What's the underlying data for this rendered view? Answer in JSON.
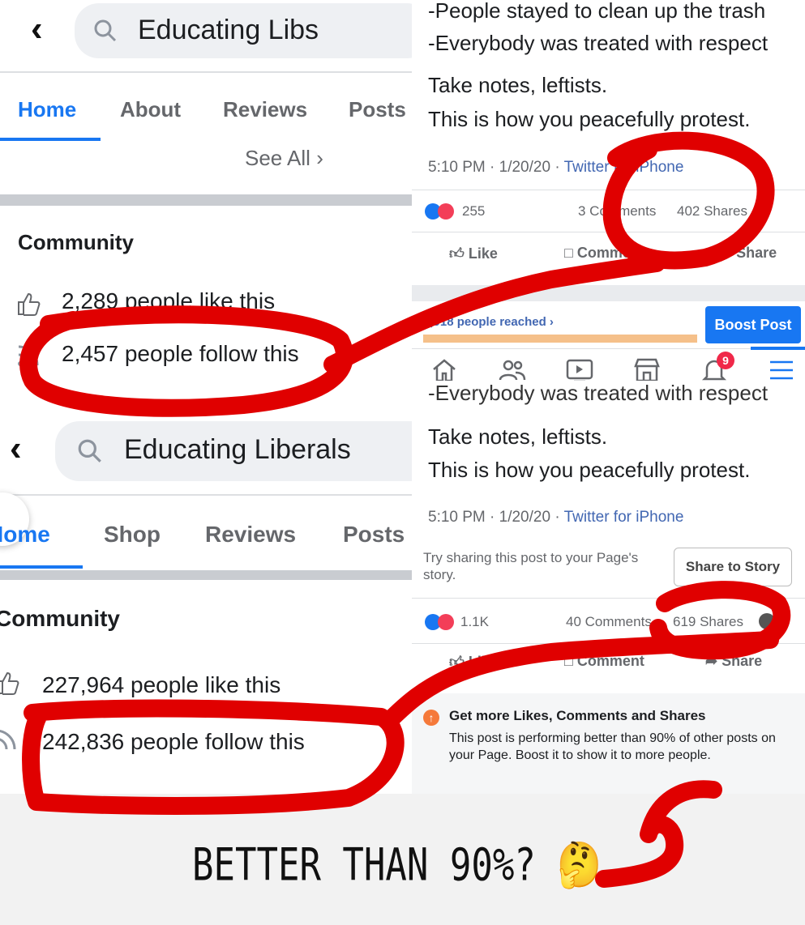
{
  "top_left": {
    "search_value": "Educating Libs",
    "tabs": [
      "Home",
      "About",
      "Reviews",
      "Posts"
    ],
    "see_all": "See All",
    "community_title": "Community",
    "likes": "2,289 people like this",
    "follows": "2,457 people follow this"
  },
  "top_right": {
    "post_lines": [
      "-People stayed to clean up the trash",
      "-Everybody was treated with respect"
    ],
    "take_notes": "Take notes, leftists.",
    "protest": "This is how you peacefully protest.",
    "time": "5:10 PM · 1/20/20 · ",
    "source": "Twitter for iPhone",
    "reactions": "255",
    "comments": "3 Comments",
    "shares": "402 Shares",
    "like": "Like",
    "comment": "Comment",
    "share": "Share",
    "reached": "2,918 people reached",
    "boost": "Boost Post",
    "notif_count": "9"
  },
  "bottom_left": {
    "search_value": "Educating Liberals",
    "tabs": [
      "Home",
      "Shop",
      "Reviews",
      "Posts"
    ],
    "community_title": "Community",
    "likes": "227,964 people like this",
    "follows": "242,836 people follow this"
  },
  "bottom_right": {
    "cut_line": "-Everybody was treated with respect",
    "take_notes": "Take notes, leftists.",
    "protest": "This is how you peacefully protest.",
    "time": "5:10 PM · 1/20/20 · ",
    "source": "Twitter for iPhone",
    "try_sharing": "Try sharing this post to your Page's story.",
    "share_story": "Share to Story",
    "reactions": "1.1K",
    "comments": "40 Comments",
    "shares": "619 Shares",
    "like": "Like",
    "comment": "Comment",
    "share": "Share",
    "tip_title": "Get more Likes, Comments and Shares",
    "tip_body": "This post is performing better than 90% of other posts on your Page. Boost it to show it to more people."
  },
  "caption": "BETTER THAN 90%? 🤔",
  "colors": {
    "accent": "#1877f2",
    "ink": "#e00000"
  }
}
